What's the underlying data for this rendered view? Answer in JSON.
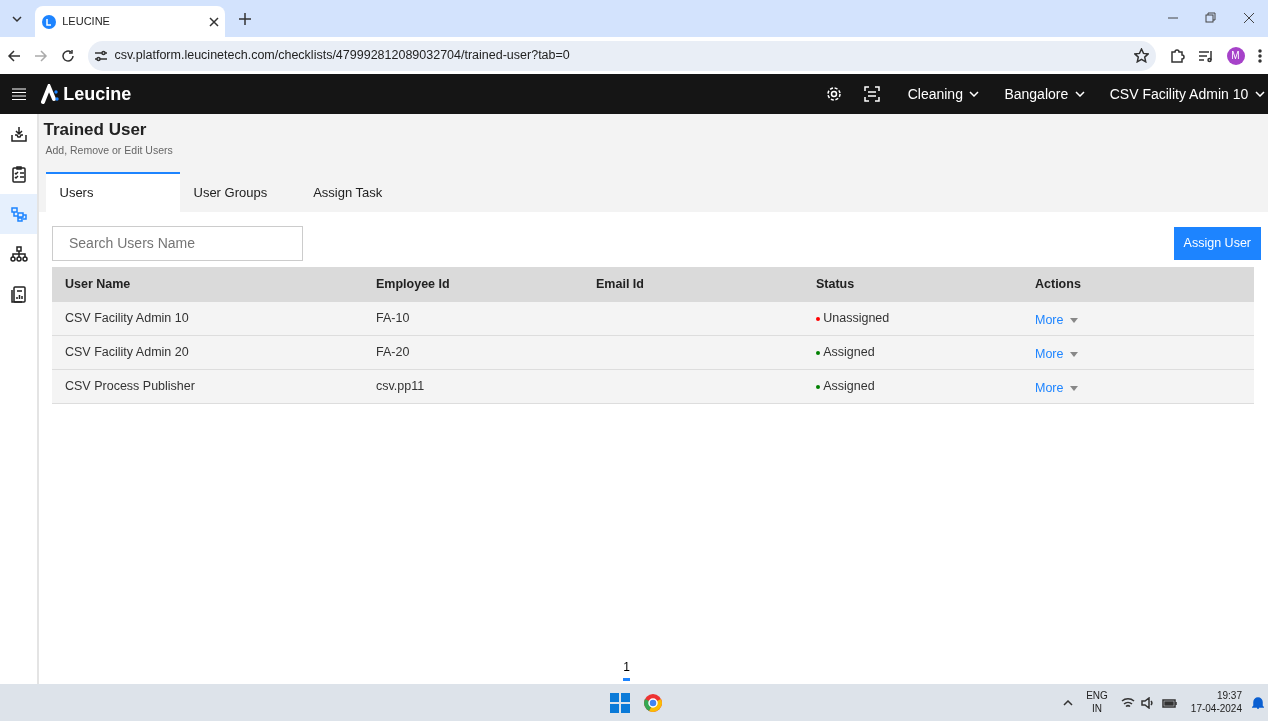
{
  "browser": {
    "tab_title": "LEUCINE",
    "url": "csv.platform.leucinetech.com/checklists/479992812089032704/trained-user?tab=0",
    "profile_initial": "M"
  },
  "app": {
    "brand": "Leucine",
    "menus": [
      {
        "label": "Cleaning"
      },
      {
        "label": "Bangalore"
      },
      {
        "label": "CSV Facility Admin 10"
      }
    ]
  },
  "sidebar": {
    "items": [
      {
        "kind": "inbox",
        "selected": false
      },
      {
        "kind": "checklist",
        "selected": false
      },
      {
        "kind": "process",
        "selected": true
      },
      {
        "kind": "hierarchy",
        "selected": false
      },
      {
        "kind": "report",
        "selected": false
      }
    ]
  },
  "page": {
    "title": "Trained User",
    "subtitle": "Add, Remove or Edit Users",
    "tabs": [
      {
        "label": "Users",
        "selected": true
      },
      {
        "label": "User Groups",
        "selected": false
      },
      {
        "label": "Assign Task",
        "selected": false
      }
    ],
    "search": {
      "placeholder": "Search Users Name"
    },
    "assign_button": "Assign User",
    "table": {
      "columns": [
        "User Name",
        "Employee Id",
        "Email Id",
        "Status",
        "Actions"
      ],
      "rows": [
        {
          "user_name": "CSV Facility Admin 10",
          "employee_id": "FA-10",
          "status": "Unassigned",
          "color": "#ff0000",
          "action": "More"
        },
        {
          "user_name": "CSV Facility Admin 20",
          "employee_id": "FA-20",
          "status": "Assigned",
          "color": "#008000",
          "action": "More"
        },
        {
          "user_name": "CSV Process Publisher",
          "employee_id": "csv.pp11",
          "status": "Assigned",
          "color": "#008000",
          "action": "More"
        }
      ]
    },
    "pagination": [
      {
        "label": "1",
        "selected": true
      }
    ]
  },
  "taskbar": {
    "language": "ENG",
    "region": "IN",
    "time": "19:37",
    "date": "17-04-2024"
  }
}
